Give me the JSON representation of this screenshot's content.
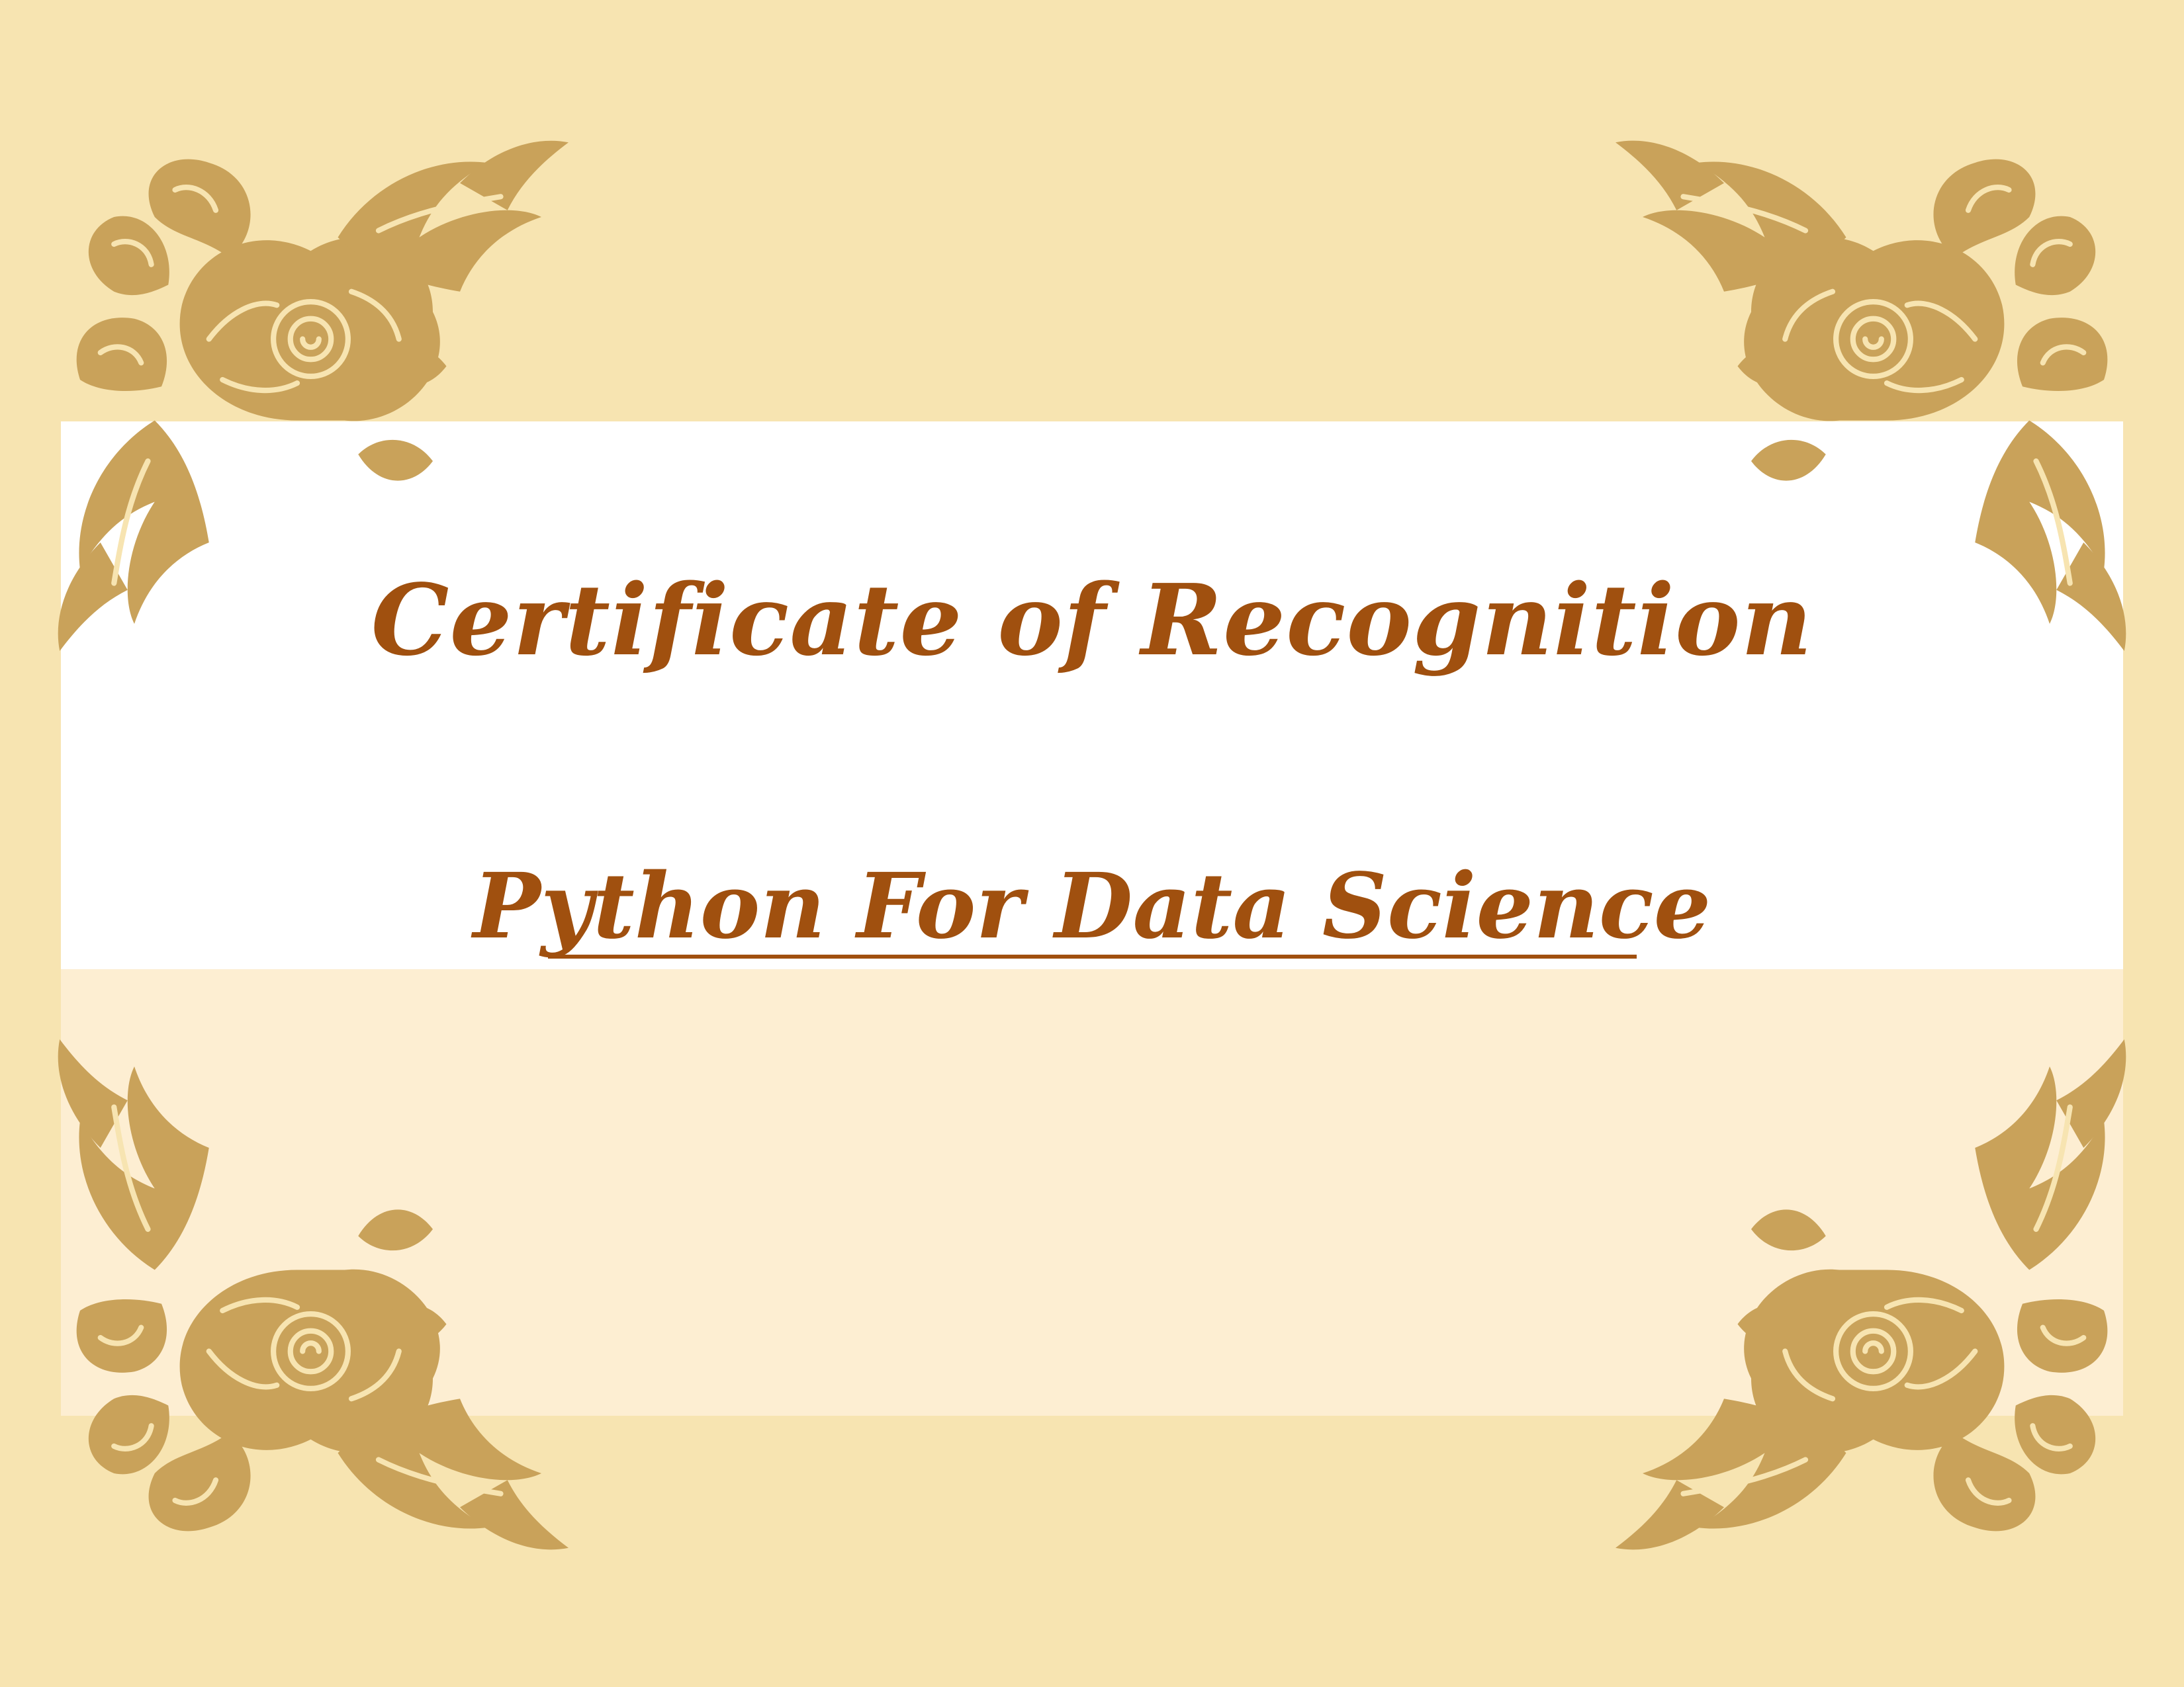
{
  "certificate": {
    "title": "Certificate of Recognition",
    "course": "Python For Data Science"
  },
  "colors": {
    "background": "#f7e4b1",
    "band_white": "#ffffff",
    "band_cream": "#fdeed2",
    "text": "#a0500f",
    "ornament": "#c9a25a",
    "ornament_light": "#e2c78f"
  },
  "ornaments": [
    "floral-corner-ornament",
    "floral-corner-ornament",
    "floral-corner-ornament",
    "floral-corner-ornament"
  ]
}
